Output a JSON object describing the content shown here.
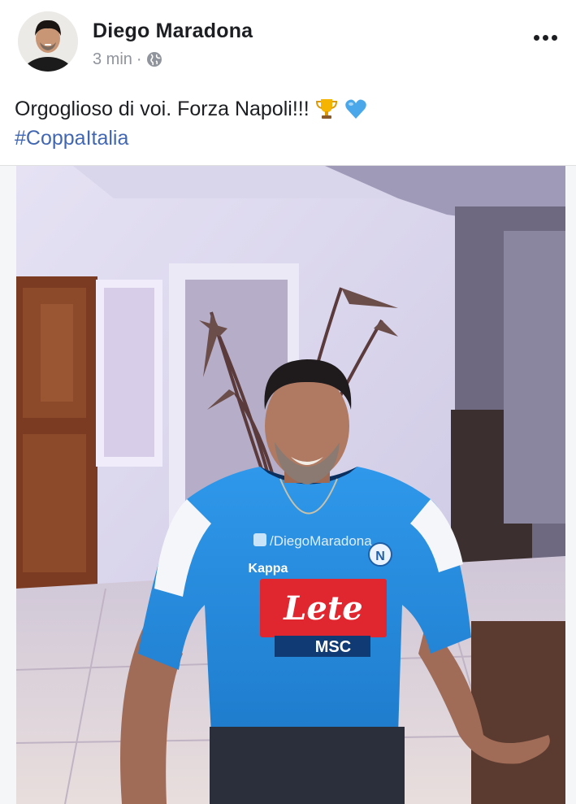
{
  "post": {
    "author": "Diego Maradona",
    "time": "3 min",
    "separator": "·",
    "privacy_icon": "globe-icon",
    "message": "Orgoglioso di voi. Forza Napoli!!!",
    "emojis": [
      "trophy-emoji",
      "blue-heart-emoji"
    ],
    "hashtag": "#CoppaItalia",
    "more_icon": "more-options-icon"
  },
  "photo": {
    "watermark": "/DiegoMaradona",
    "sponsor": "Lete",
    "sponsor_secondary": "MSC",
    "brand": "Kappa",
    "badge": "N"
  },
  "colors": {
    "link": "#4267b2",
    "text": "#1c1e21",
    "meta": "#90949c",
    "jersey_blue": "#2a8fe0",
    "sponsor_red": "#e0262f"
  }
}
